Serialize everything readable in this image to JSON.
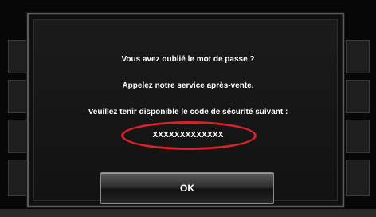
{
  "dialog": {
    "question": "Vous avez oublié le mot de passe ?",
    "instruction": "Appelez notre service après-vente.",
    "code_prompt": "Veuillez tenir disponible le code de sécurité suivant :",
    "security_code": "XXXXXXXXXXXXX",
    "ok_label": "OK"
  },
  "annotation": {
    "color": "#d8232a"
  }
}
